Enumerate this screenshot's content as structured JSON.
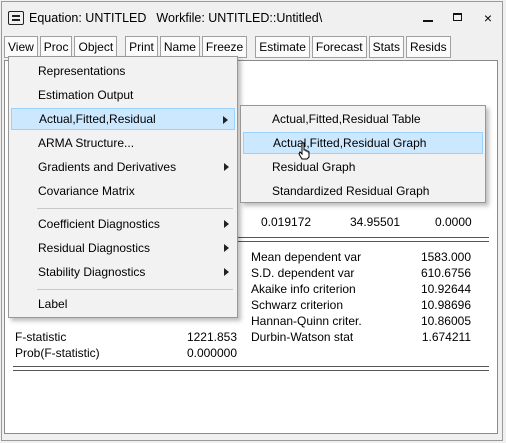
{
  "window": {
    "title_equation": "Equation: UNTITLED",
    "title_workfile": "Workfile: UNTITLED::Untitled\\",
    "controls": {
      "minimize": "minimize-icon",
      "maximize": "maximize-icon",
      "close": "×"
    }
  },
  "toolbar": {
    "buttons": [
      "View",
      "Proc",
      "Object",
      "Print",
      "Name",
      "Freeze",
      "Estimate",
      "Forecast",
      "Stats",
      "Resids"
    ]
  },
  "menu": {
    "items": [
      {
        "label": "Representations",
        "submenu": false
      },
      {
        "label": "Estimation Output",
        "submenu": false
      },
      {
        "label": "Actual,Fitted,Residual",
        "submenu": true,
        "highlighted": true
      },
      {
        "label": "ARMA Structure...",
        "submenu": false
      },
      {
        "label": "Gradients and Derivatives",
        "submenu": true
      },
      {
        "label": "Covariance Matrix",
        "submenu": false
      },
      {
        "label": "Coefficient Diagnostics",
        "submenu": true
      },
      {
        "label": "Residual Diagnostics",
        "submenu": true
      },
      {
        "label": "Stability Diagnostics",
        "submenu": true
      },
      {
        "label": "Label",
        "submenu": false
      }
    ]
  },
  "submenu": {
    "items": [
      {
        "label": "Actual,Fitted,Residual Table"
      },
      {
        "label": "Actual,Fitted,Residual Graph",
        "highlighted": true
      },
      {
        "label": "Residual Graph"
      },
      {
        "label": "Standardized Residual Graph"
      }
    ]
  },
  "output": {
    "coef_row": {
      "std_error": "0.019172",
      "t_stat": "34.95501",
      "prob": "0.0000"
    },
    "stats_right": [
      {
        "label": "Mean dependent var",
        "value": "1583.000"
      },
      {
        "label": "S.D. dependent var",
        "value": "610.6756"
      },
      {
        "label": "Akaike info criterion",
        "value": "10.92644"
      },
      {
        "label": "Schwarz criterion",
        "value": "10.98696"
      },
      {
        "label": "Hannan-Quinn criter.",
        "value": "10.86005"
      },
      {
        "label": "Durbin-Watson stat",
        "value": "1.674211"
      }
    ],
    "stats_left": [
      {
        "label": "F-statistic",
        "value": "1221.853"
      },
      {
        "label": "Prob(F-statistic)",
        "value": "0.000000"
      }
    ]
  },
  "colors": {
    "highlight": "#cce8ff",
    "highlight_border": "#99d1ff",
    "menu_bg": "#f2f2f2"
  }
}
